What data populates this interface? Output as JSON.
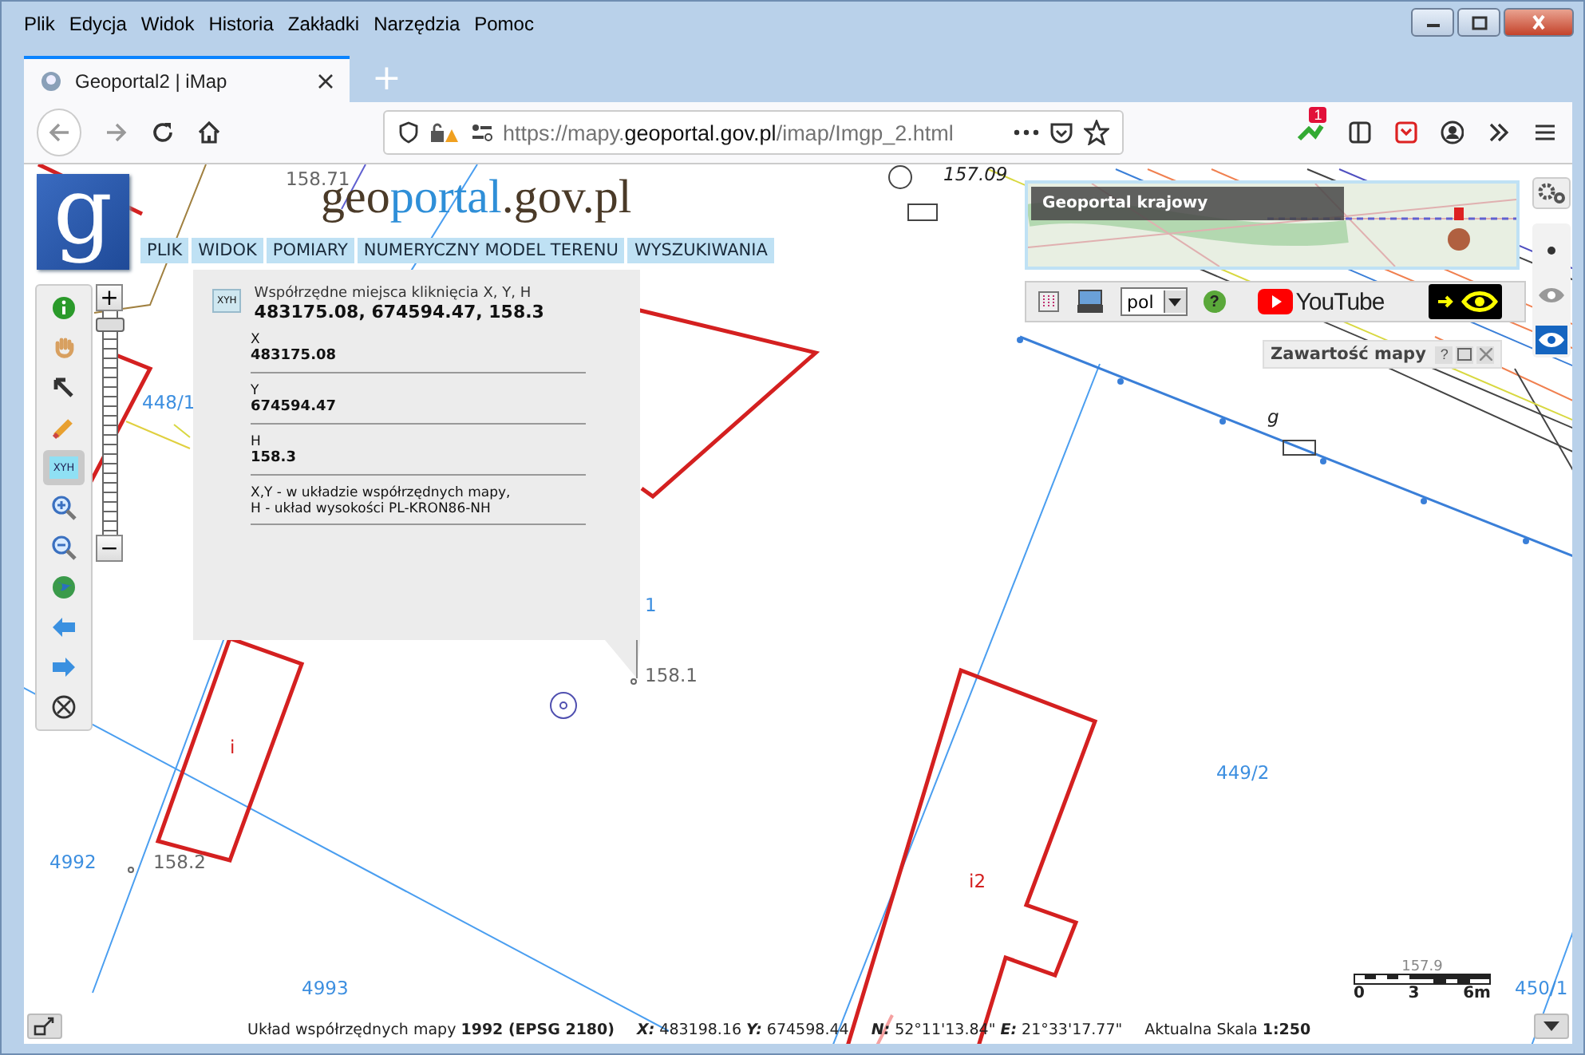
{
  "browser": {
    "menu": [
      "Plik",
      "Edycja",
      "Widok",
      "Historia",
      "Zakładki",
      "Narzędzia",
      "Pomoc"
    ],
    "tabs": [
      {
        "title": "Geoportal2 | iMap",
        "selected": true
      }
    ],
    "new_tab": "+",
    "url": {
      "scheme": "https://mapy.",
      "domain": "geoportal.gov.pl",
      "path": "/imap/Imgp_2.html"
    },
    "extension_badge": "1"
  },
  "app": {
    "logo_letter": "g",
    "logo_parts": [
      "geo",
      "portal",
      ".gov.pl"
    ],
    "menu": [
      "PLIK",
      "WIDOK",
      "POMIARY",
      "NUMERYCZNY MODEL TERENU",
      "WYSZUKIWANIA"
    ],
    "tools": [
      {
        "kind": "info",
        "selected": false
      },
      {
        "kind": "pan",
        "selected": false
      },
      {
        "kind": "pointer",
        "selected": false
      },
      {
        "kind": "pencil",
        "selected": false
      },
      {
        "kind": "xyh",
        "label": "XYH",
        "selected": true
      },
      {
        "kind": "zoom-in",
        "selected": false
      },
      {
        "kind": "zoom-out",
        "selected": false
      },
      {
        "kind": "globe",
        "selected": false
      },
      {
        "kind": "back",
        "selected": false
      },
      {
        "kind": "forward",
        "selected": false
      },
      {
        "kind": "clear",
        "selected": false
      }
    ],
    "zoom": {
      "plus": "+",
      "minus": "−",
      "level": 0.97
    },
    "popup": {
      "icon_label": "XYH",
      "title": "Współrzędne miejsca kliknięcia X, Y, H",
      "coords": "483175.08, 674594.47, 158.3",
      "fields": [
        {
          "label": "X",
          "value": "483175.08"
        },
        {
          "label": "Y",
          "value": "674594.47"
        },
        {
          "label": "H",
          "value": "158.3"
        }
      ],
      "note": [
        "X,Y - w układzie współrzędnych mapy,",
        "H - układ wysokości PL-KRON86-NH"
      ]
    },
    "overview": {
      "title": "Geoportal krajowy"
    },
    "toolbar": {
      "language": "pol",
      "help": "?",
      "video_label": "YouTube"
    },
    "layers_panel": {
      "title": "Zawartość mapy",
      "help": "?"
    },
    "side_buttons": [
      {
        "kind": "dot",
        "selected": false
      },
      {
        "kind": "eye",
        "selected": false
      },
      {
        "kind": "eye",
        "selected": true
      }
    ],
    "map_labels": [
      {
        "text": "158.71",
        "kind": "height"
      },
      {
        "text": "157.09",
        "kind": "line"
      },
      {
        "text": "448/1",
        "kind": "parcel"
      },
      {
        "text": "1",
        "kind": "parcel"
      },
      {
        "text": "g",
        "kind": "line"
      },
      {
        "text": "158.1",
        "kind": "height"
      },
      {
        "text": "i",
        "kind": "building"
      },
      {
        "text": "449/2",
        "kind": "parcel"
      },
      {
        "text": "4992",
        "kind": "parcel"
      },
      {
        "text": "158.2",
        "kind": "height"
      },
      {
        "text": "i2",
        "kind": "building"
      },
      {
        "text": "4993",
        "kind": "parcel"
      },
      {
        "text": "450/1",
        "kind": "parcel"
      }
    ],
    "scale": {
      "value": "157.9",
      "ticks": [
        "0",
        "3",
        "6m"
      ]
    },
    "status": [
      "Układ współrzędnych mapy **1992 (EPSG 2180)**",
      "*X:* 483198.16 *Y:* 674598.44",
      "*N:* 52°11'13.84\" *E:* 21°33'17.77\"",
      "Aktualna Skala **1:250**"
    ]
  }
}
